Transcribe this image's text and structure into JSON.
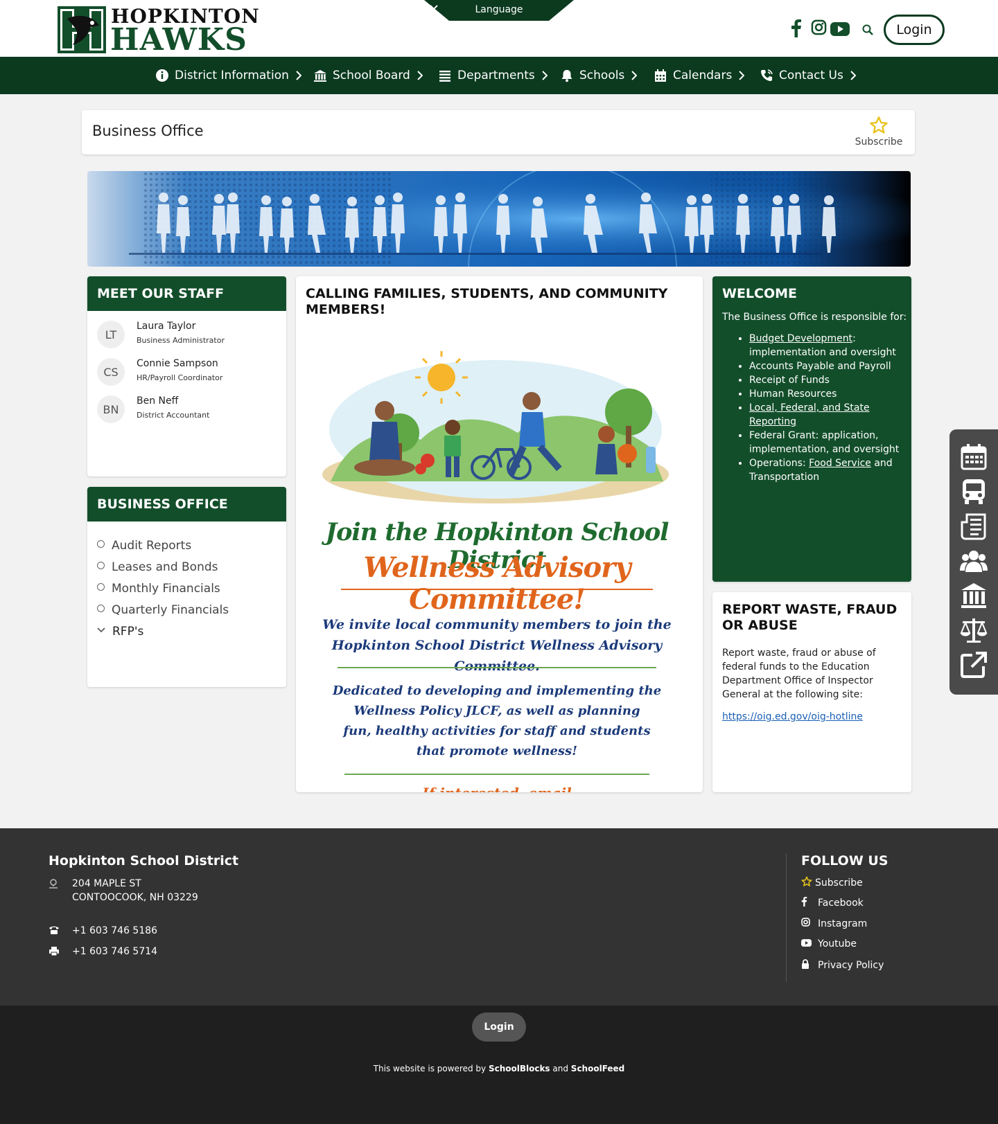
{
  "header": {
    "logo_line1": "HOPKINTON",
    "logo_line2": "HAWKS",
    "language_label": "Language",
    "login_label": "Login",
    "social_icons": [
      "facebook-icon",
      "instagram-icon",
      "youtube-icon",
      "search-icon"
    ]
  },
  "nav": {
    "items": [
      {
        "label": "District Information",
        "icon": "info-icon"
      },
      {
        "label": "School Board",
        "icon": "building-icon"
      },
      {
        "label": "Departments",
        "icon": "list-icon"
      },
      {
        "label": "Schools",
        "icon": "bell-icon"
      },
      {
        "label": "Calendars",
        "icon": "calendar-icon"
      },
      {
        "label": "Contact Us",
        "icon": "phone-icon"
      }
    ]
  },
  "page": {
    "title": "Business Office",
    "subscribe_label": "Subscribe"
  },
  "staff": {
    "heading": "MEET OUR STAFF",
    "members": [
      {
        "initials": "LT",
        "name": "Laura Taylor",
        "title": "Business Administrator"
      },
      {
        "initials": "CS",
        "name": "Connie Sampson",
        "title": "HR/Payroll Coordinator"
      },
      {
        "initials": "BN",
        "name": "Ben Neff",
        "title": "District Accountant"
      }
    ]
  },
  "business_office": {
    "heading": "BUSINESS OFFICE",
    "items": [
      "Audit Reports",
      "Leases and Bonds",
      "Monthly Financials",
      "Quarterly Financials",
      "RFP's"
    ]
  },
  "center": {
    "heading": "CALLING FAMILIES, STUDENTS, AND COMMUNITY MEMBERS!",
    "poster_line1": "Join the Hopkinton School District",
    "poster_line2": "Wellness Advisory Committee!",
    "poster_invite1": "We invite local community members to join the",
    "poster_invite2": "Hopkinton School District Wellness Advisory Committee.",
    "poster_dedicated1": "Dedicated to developing and implementing the",
    "poster_dedicated2": "Wellness Policy JLCF, as well as planning",
    "poster_dedicated3": "fun, healthy activities for staff and students",
    "poster_dedicated4": "that promote wellness!",
    "poster_cut": "If interested, email"
  },
  "welcome": {
    "heading": "WELCOME",
    "intro": "The Business Office is responsible for:",
    "items": [
      {
        "link": "Budget Development",
        "rest": ": implementation and oversight"
      },
      {
        "link": "",
        "rest": "Accounts Payable and Payroll"
      },
      {
        "link": "",
        "rest": "Receipt of Funds"
      },
      {
        "link": "",
        "rest": "Human Resources"
      },
      {
        "link": "Local, Federal, and State Reporting",
        "rest": ""
      },
      {
        "link": "",
        "rest": "Federal Grant: application, implementation, and oversight"
      },
      {
        "pre": "Operations: ",
        "link": "Food Service",
        "rest": " and Transportation"
      }
    ]
  },
  "fraud": {
    "heading": "REPORT WASTE, FRAUD OR ABUSE",
    "body": "Report waste, fraud or abuse of federal funds to the Education Department Office of Inspector General at the following site:",
    "link": "https://oig.ed.gov/oig-hotline"
  },
  "tools": [
    "calendar-icon",
    "bus-icon",
    "newspaper-icon",
    "people-icon",
    "building-icon",
    "scales-icon",
    "external-link-icon"
  ],
  "footer": {
    "district_name": "Hopkinton School District",
    "address_line1": "204 MAPLE ST",
    "address_line2": "CONTOOCOOK, NH 03229",
    "phone": "+1 603 746 5186",
    "fax": "+1 603 746 5714",
    "follow_heading": "FOLLOW US",
    "links": [
      "Subscribe",
      "Facebook",
      "Instagram",
      "Youtube",
      "Privacy Policy"
    ],
    "login_label": "Login",
    "powered_pre": "This website is powered by ",
    "powered_a": "SchoolBlocks",
    "powered_and": " and ",
    "powered_b": "SchoolFeed"
  },
  "colors": {
    "brand_green": "#134e2b",
    "nav_green": "#0b3a1f",
    "accent_orange": "#e0651c",
    "star_yellow": "#e8c21a"
  }
}
